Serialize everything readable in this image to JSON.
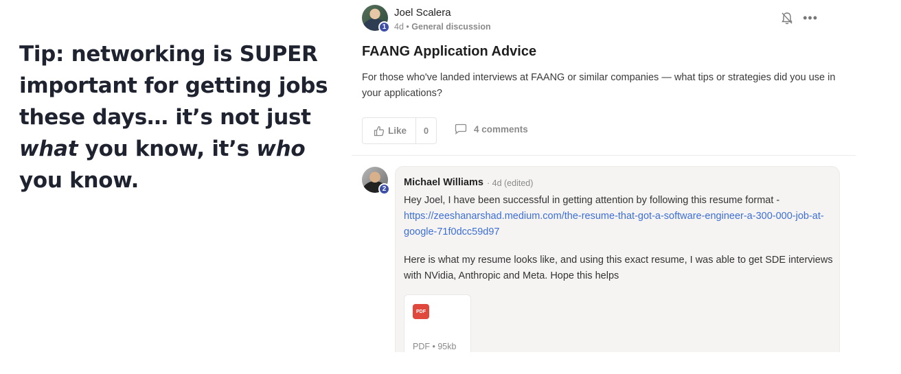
{
  "tip": {
    "part1": "Tip: networking is SUPER important for getting jobs these days… it’s not just ",
    "what": "what",
    "part2": " you know, it’s ",
    "who": "who",
    "part3": " you know."
  },
  "post": {
    "author": "Joel Scalera",
    "level": "1",
    "time": "4d",
    "separator": "•",
    "category": "General discussion",
    "title": "FAANG Application Advice",
    "body": "For those who've landed interviews at FAANG or similar companies — what tips or strategies did you use in your applications?",
    "like_label": "Like",
    "like_count": "0",
    "comments_label": "4 comments",
    "icons": {
      "bell": "bell-off-icon",
      "more": "more-horizontal-icon",
      "like": "thumbs-up-icon",
      "comment": "comment-icon"
    }
  },
  "comment": {
    "author": "Michael Williams",
    "level": "2",
    "meta": "· 4d (edited)",
    "text1": "Hey Joel, I have been successful in getting attention by following this resume format -",
    "link": "https://zeeshanarshad.medium.com/the-resume-that-got-a-software-engineer-a-300-000-job-at-google-71f0dcc59d97",
    "text2": "Here is what my resume looks like, and using this exact resume, I was able to get SDE interviews with NVidia, Anthropic and Meta. Hope this helps",
    "attachment": {
      "icon_label": "PDF",
      "meta": "PDF • 95kb"
    }
  },
  "colors": {
    "accent_link": "#3d6ed8",
    "badge": "#3e4fa8",
    "pdf": "#e0483e"
  }
}
